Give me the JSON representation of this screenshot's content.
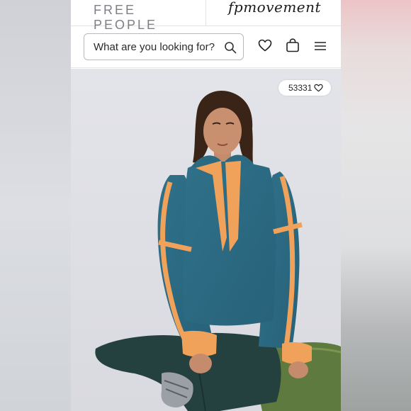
{
  "header": {
    "brand_primary": "FREE PEOPLE",
    "brand_secondary": "fpmovement"
  },
  "search": {
    "placeholder": "What are you looking for?",
    "icon": "search-icon"
  },
  "nav_icons": [
    "heart-icon",
    "shopping-bag-icon",
    "menu-icon"
  ],
  "product": {
    "like_count": "53331",
    "colors": {
      "pullover": "#2f6f86",
      "trim": "#f0a15a",
      "pants": "#24403f",
      "cushion": "#5f7a3e"
    }
  }
}
